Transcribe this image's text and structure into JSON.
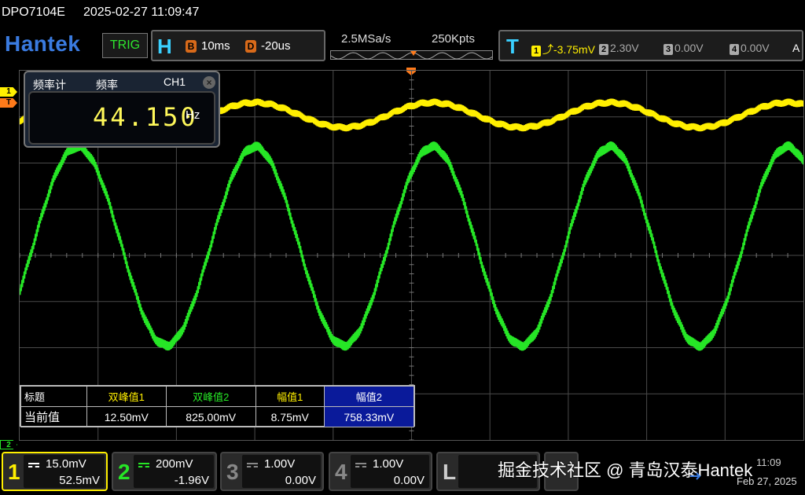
{
  "titlebar": {
    "model": "DPO7104E",
    "datetime": "2025-02-27 11:09:47"
  },
  "header": {
    "logo": "Hantek",
    "trig_label": "TRIG",
    "horizontal": {
      "label": "H",
      "b_badge": "B",
      "timebase": "10ms",
      "d_badge": "D",
      "delay": "-20us"
    },
    "sample_rate": "2.5MSa/s",
    "record_length": "250Kpts",
    "trigger": {
      "label": "T",
      "ch1": {
        "num": "1",
        "value": "-3.75mV"
      },
      "ch2": {
        "num": "2",
        "value": "2.30V"
      },
      "ch3": {
        "num": "3",
        "value": "0.00V"
      },
      "ch4": {
        "num": "4",
        "value": "0.00V"
      },
      "mode": "A"
    }
  },
  "markers": {
    "ch1": "1",
    "trig": "T",
    "ch2": "2"
  },
  "freq_counter": {
    "title": "频率计",
    "label": "频率",
    "channel": "CH1",
    "close": "×",
    "value": "44.150",
    "unit": "Hz"
  },
  "measurements": {
    "row_header": "标题",
    "row_value": "当前值",
    "columns": [
      {
        "name": "双峰值1",
        "value": "12.50mV",
        "color": "#ffef00"
      },
      {
        "name": "双峰值2",
        "value": "825.00mV",
        "color": "#26e626"
      },
      {
        "name": "幅值1",
        "value": "8.75mV",
        "color": "#ffef00"
      },
      {
        "name": "幅值2",
        "value": "758.33mV",
        "color": "#ffffff",
        "selected": true
      }
    ]
  },
  "channels": [
    {
      "num": "1",
      "scale": "15.0mV",
      "offset": "52.5mV",
      "color": "#ffef00"
    },
    {
      "num": "2",
      "scale": "200mV",
      "offset": "-1.96V",
      "color": "#26e626"
    },
    {
      "num": "3",
      "scale": "1.00V",
      "offset": "0.00V",
      "color": "#888888"
    },
    {
      "num": "4",
      "scale": "1.00V",
      "offset": "0.00V",
      "color": "#888888"
    }
  ],
  "l_channel": {
    "label": "L"
  },
  "watermark": "掘金技术社区 @ 青岛汉泰Hantek",
  "clock": {
    "time": "11:09",
    "date": "Feb 27, 2025"
  },
  "waveform": {
    "ch1": {
      "color": "#ffef00",
      "frequency_hz": 44.15,
      "amplitude_div": 0.27,
      "center_div": 0.96
    },
    "ch2": {
      "color": "#26e626",
      "frequency_hz": 44.15,
      "amplitude_div": 2.15,
      "center_div": 3.8
    },
    "time_div_ms": 10,
    "h_divs": 10,
    "v_divs": 8
  }
}
